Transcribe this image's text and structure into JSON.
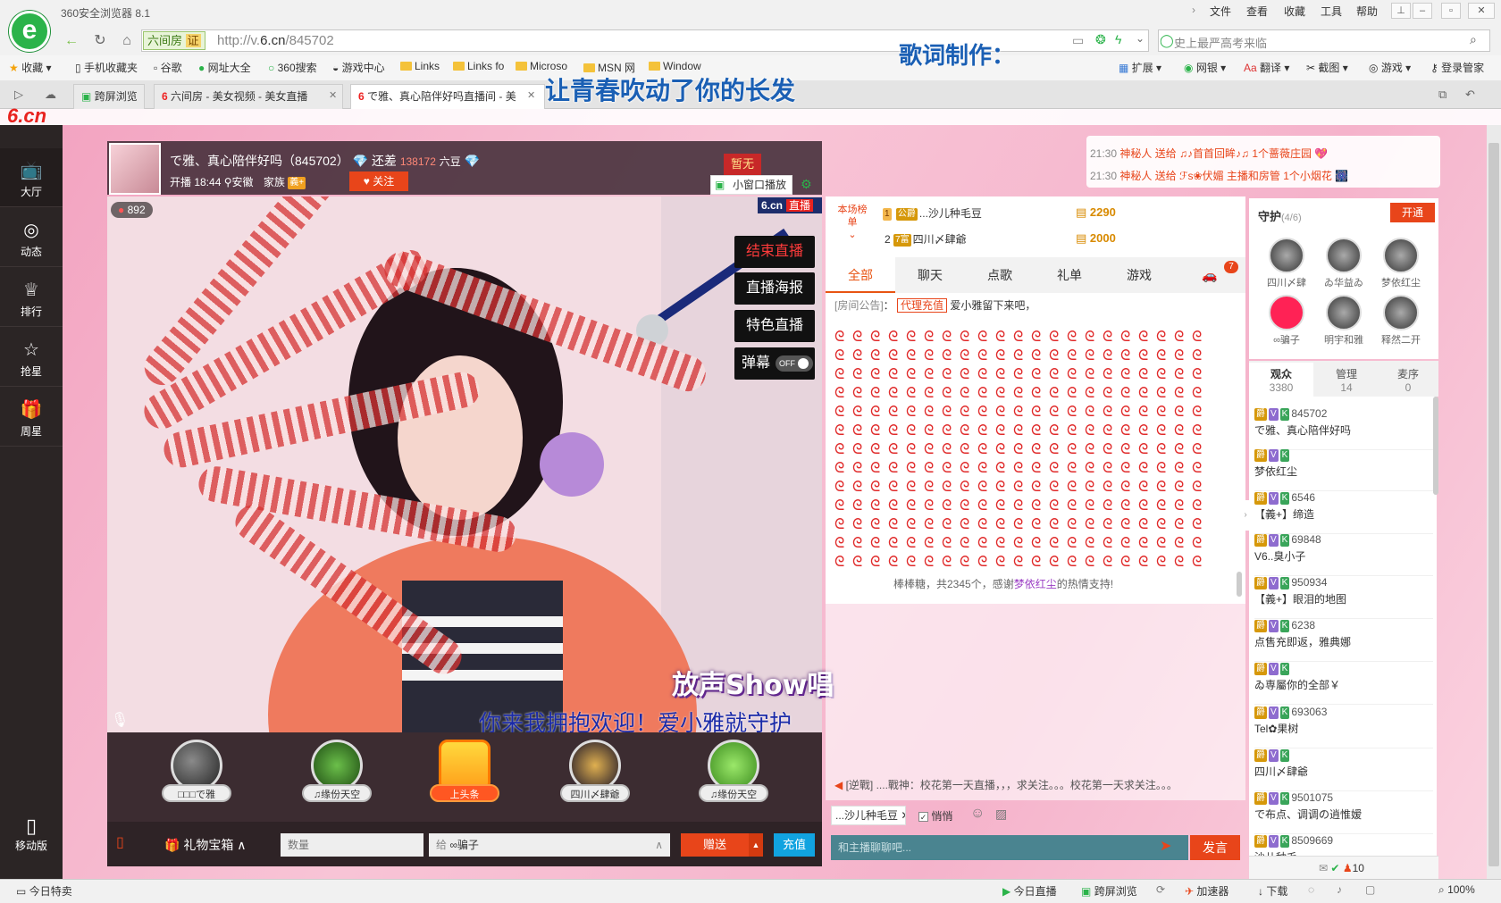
{
  "browser": {
    "app_name": "360安全浏览器 8.1",
    "menus": [
      "文件",
      "查看",
      "收藏",
      "工具",
      "帮助"
    ],
    "site_badge": "六间房",
    "site_badge_tag": "证",
    "url_prefix": "http://v.",
    "url_domain": "6.cn",
    "url_path": "/845702",
    "search_placeholder": "史上最严高考来临",
    "favorites": [
      "收藏",
      "手机收藏夹",
      "谷歌",
      "网址大全",
      "360搜索",
      "游戏中心",
      "Links",
      "Links fo",
      "Microso",
      "MSN 网",
      "Window"
    ],
    "toolbar_right": [
      "扩展",
      "网银",
      "翻译",
      "截图",
      "游戏",
      "登录管家"
    ],
    "tabs": [
      "跨屏浏览",
      "六间房 - 美女视频 - 美女直播",
      "で雅、真心陪伴好吗直播间 - 美"
    ]
  },
  "lyrics": {
    "heading": "歌词制作：",
    "line": "让青春吹动了你的长发"
  },
  "site": {
    "logo": "6.cn",
    "left_nav": [
      "大厅",
      "动态",
      "排行",
      "抢星",
      "周星"
    ],
    "mobile": "移动版"
  },
  "anchor": {
    "title": "で雅、真心陪伴好吗（845702）",
    "gap_label": "还差",
    "gap_value": "138172",
    "gap_unit": "六豆",
    "live_since": "开播 18:44",
    "location": "安徽",
    "family_label": "家族",
    "follow": "关注",
    "mini_window": "小窗口播放",
    "tag_none": "暂无",
    "wealth_count": "892",
    "brand": "6.cn",
    "brand_live": "直播"
  },
  "video_buttons": [
    "结束直播",
    "直播海报",
    "特色直播",
    "弹幕"
  ],
  "barrage_toggle": "OFF",
  "video_overlay": {
    "logo_text": "放声Show唱",
    "scroll_text": "你来我拥抱欢迎！爱小雅就守护"
  },
  "gift_users": [
    "□□□で雅",
    "♫缘份天空",
    "上头条",
    "四川〆肆爺",
    "♫缘份天空"
  ],
  "bottom_bar": {
    "gift_box": "礼物宝箱",
    "qty_placeholder": "数量",
    "to_label": "给",
    "to_user": "∞骗子",
    "give_button": "赠送",
    "recharge_button": "充值"
  },
  "rank": {
    "label": "本场榜单",
    "rows": [
      {
        "rank": "1",
        "name": "...沙儿种毛豆",
        "score": "2290"
      },
      {
        "rank": "2",
        "name": "四川〆肆爺",
        "score": "2000"
      }
    ]
  },
  "chat": {
    "tabs": [
      "全部",
      "聊天",
      "点歌",
      "礼单",
      "游戏"
    ],
    "car_badge": "7",
    "notice_label": "[房间公告]",
    "notice_tag": "代理充值",
    "notice_text": "爱小雅留下来吧，",
    "gift_summary": "棒棒糖，共2345个，感谢",
    "gift_sender": "梦依红尘",
    "gift_thanks": "的热情支持!",
    "marquee": "[逆戰] ....戰神：校花第一天直播，，，求关注。。。校花第一天求关注。。。",
    "at_user": "...沙儿种毛豆",
    "whisper": "悄悄",
    "input_placeholder": "和主播聊聊吧...",
    "send": "发言"
  },
  "notices": [
    {
      "time": "21:30",
      "text": "神秘人 送给 ♫♪首首回眸♪♫ 1个蔷薇庄园"
    },
    {
      "time": "21:30",
      "text": "神秘人 送给 ℱs❀伏媚 主播和房管 1个小烟花"
    }
  ],
  "guard": {
    "title": "守护",
    "count": "(4/6)",
    "open": "开通",
    "members": [
      "四川〆肆",
      "ゐ华益ゐ",
      "梦依红尘",
      "∞骗子",
      "明宇和雅",
      "释然二开"
    ]
  },
  "audience_tabs": [
    {
      "label": "观众",
      "count": "3380"
    },
    {
      "label": "管理",
      "count": "14"
    },
    {
      "label": "麦序",
      "count": "0"
    }
  ],
  "users": [
    {
      "id": "845702",
      "name": "で雅、真心陪伴好吗"
    },
    {
      "id": "",
      "name": "梦依红尘"
    },
    {
      "id": "6546",
      "name": "【義+】缔造"
    },
    {
      "id": "69848",
      "name": "V6..臭小子"
    },
    {
      "id": "950934",
      "name": "【義+】眼泪的地图"
    },
    {
      "id": "6238",
      "name": "点售充即返，雅典娜"
    },
    {
      "id": "",
      "name": "ゐ専屬你的全部￥"
    },
    {
      "id": "693063",
      "name": "Tel✿果树"
    },
    {
      "id": "",
      "name": "四川〆肆爺"
    },
    {
      "id": "9501075",
      "name": "で布点、调调の逍惟嫒"
    },
    {
      "id": "8509669",
      "name": "沙儿种毛"
    }
  ],
  "userlist_footer_count": "10",
  "status": [
    "今日特卖",
    "今日直播",
    "跨屏浏览",
    "加速器",
    "下载",
    "100%"
  ],
  "colors": {
    "accent": "#e8451a",
    "brand_green": "#2bb34a",
    "nav_dark": "#2b2525"
  }
}
